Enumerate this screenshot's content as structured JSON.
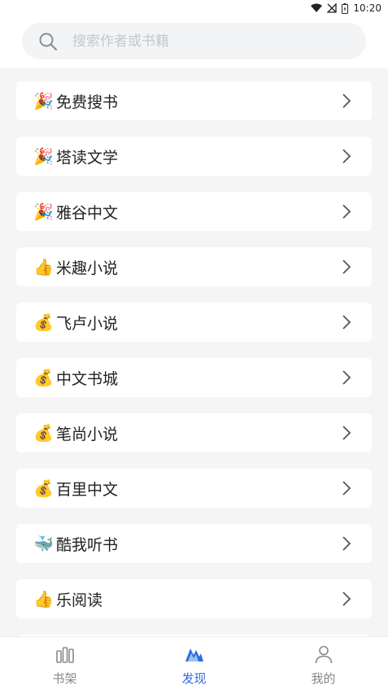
{
  "status_bar": {
    "time": "10:20"
  },
  "search": {
    "placeholder": "搜索作者或书籍"
  },
  "sources": [
    {
      "emoji": "🎉",
      "label": "免费搜书"
    },
    {
      "emoji": "🎉",
      "label": "塔读文学"
    },
    {
      "emoji": "🎉",
      "label": "雅谷中文"
    },
    {
      "emoji": "👍",
      "label": "米趣小说"
    },
    {
      "emoji": "💰",
      "label": "飞卢小说"
    },
    {
      "emoji": "💰",
      "label": "中文书城"
    },
    {
      "emoji": "💰",
      "label": "笔尚小说"
    },
    {
      "emoji": "💰",
      "label": "百里中文"
    },
    {
      "emoji": "🐳",
      "label": "酷我听书"
    },
    {
      "emoji": "👍",
      "label": "乐阅读"
    }
  ],
  "nav": {
    "tabs": [
      {
        "label": "书架",
        "icon": "bookshelf-icon"
      },
      {
        "label": "发现",
        "icon": "discover-icon"
      },
      {
        "label": "我的",
        "icon": "profile-icon"
      }
    ],
    "active_index": 1
  },
  "colors": {
    "accent": "#2f6de0",
    "background": "#f5f5f5",
    "card": "#ffffff"
  }
}
